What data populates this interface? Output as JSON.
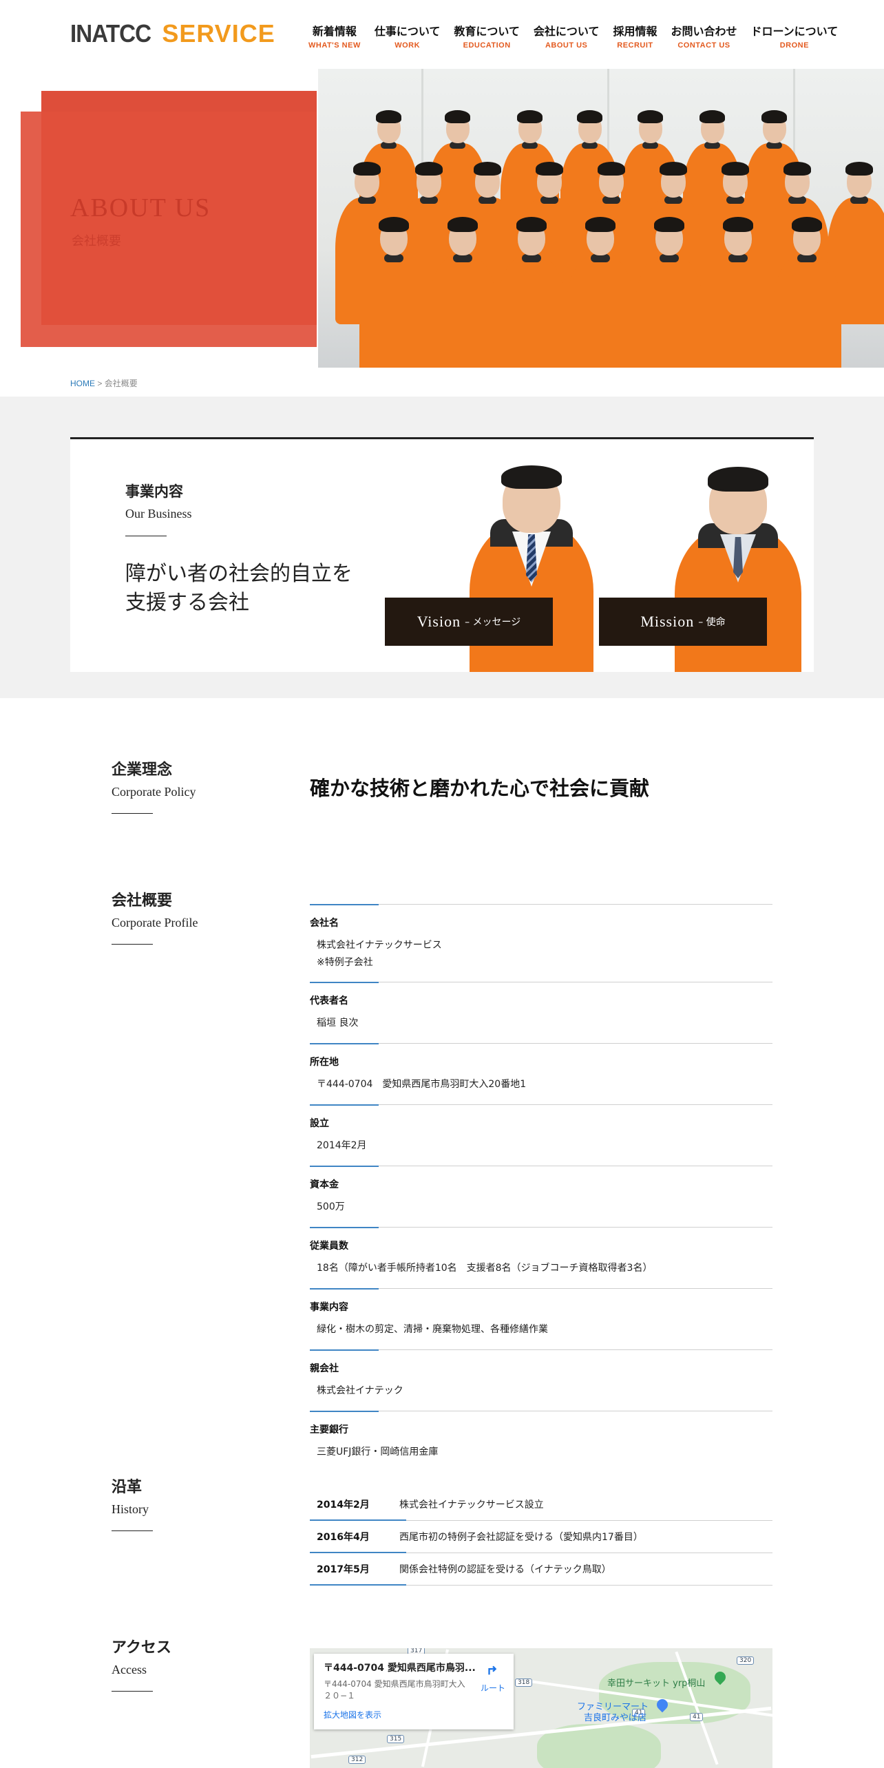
{
  "logo": {
    "brand": "INATCC",
    "service": "SERVICE"
  },
  "nav": [
    {
      "jp": "新着情報",
      "en": "WHAT'S NEW"
    },
    {
      "jp": "仕事について",
      "en": "WORK"
    },
    {
      "jp": "教育について",
      "en": "EDUCATION"
    },
    {
      "jp": "会社について",
      "en": "ABOUT US"
    },
    {
      "jp": "採用情報",
      "en": "RECRUIT"
    },
    {
      "jp": "お問い合わせ",
      "en": "CONTACT US"
    },
    {
      "jp": "ドローンについて",
      "en": "DRONE"
    }
  ],
  "hero": {
    "title": "ABOUT US",
    "subtitle": "会社概要"
  },
  "breadcrumb": {
    "home": "HOME",
    "sep": " > ",
    "current": "会社概要"
  },
  "business": {
    "jp": "事業内容",
    "en": "Our Business",
    "catch_line1": "障がい者の社会的自立を",
    "catch_line2": "支援する会社",
    "vision": {
      "big": "Vision",
      "small": "– メッセージ"
    },
    "mission": {
      "big": "Mission",
      "small": "– 使命"
    }
  },
  "policy": {
    "jp": "企業理念",
    "en": "Corporate Policy",
    "text": "確かな技術と磨かれた心で社会に貢献"
  },
  "profile": {
    "jp": "会社概要",
    "en": "Corporate Profile",
    "rows": [
      {
        "label": "会社名",
        "value": "株式会社イナテックサービス",
        "value2": "※特例子会社"
      },
      {
        "label": "代表者名",
        "value": "稲垣 良次"
      },
      {
        "label": "所在地",
        "value": "〒444-0704　愛知県西尾市鳥羽町大入20番地1"
      },
      {
        "label": "設立",
        "value": "2014年2月"
      },
      {
        "label": "資本金",
        "value": "500万"
      },
      {
        "label": "従業員数",
        "value": "18名（障がい者手帳所持者10名　支援者8名（ジョブコーチ資格取得者3名）"
      },
      {
        "label": "事業内容",
        "value": "緑化・樹木の剪定、清掃・廃棄物処理、各種修繕作業"
      },
      {
        "label": "親会社",
        "value": "株式会社イナテック"
      },
      {
        "label": "主要銀行",
        "value": "三菱UFJ銀行・岡崎信用金庫"
      }
    ]
  },
  "history": {
    "jp": "沿革",
    "en": "History",
    "rows": [
      {
        "year": "2014年2月",
        "text": "株式会社イナテックサービス設立"
      },
      {
        "year": "2016年4月",
        "text": "西尾市初の特例子会社認証を受ける（愛知県内17番目）"
      },
      {
        "year": "2017年5月",
        "text": "関係会社特例の認証を受ける（イナテック鳥取）"
      }
    ]
  },
  "access": {
    "jp": "アクセス",
    "en": "Access",
    "map": {
      "title": "〒444-0704 愛知県西尾市鳥羽...",
      "address": "〒444-0704 愛知県西尾市鳥羽町大入２０−１",
      "link": "拡大地図を表示",
      "route": "ルート",
      "place1": "幸田サーキット yrp桐山",
      "place2a": "ファミリーマート",
      "place2b": "吉良町みやば店",
      "r317": "317",
      "r320": "320",
      "r318": "318",
      "r41a": "41",
      "r41b": "41",
      "r315": "315",
      "r312": "312"
    }
  },
  "colors": {
    "accent": "#e35a1f",
    "hero_red": "#de4e3a",
    "dark_button": "#231810",
    "link_blue": "#3f85c4",
    "orange_logo": "#f29a1d"
  }
}
